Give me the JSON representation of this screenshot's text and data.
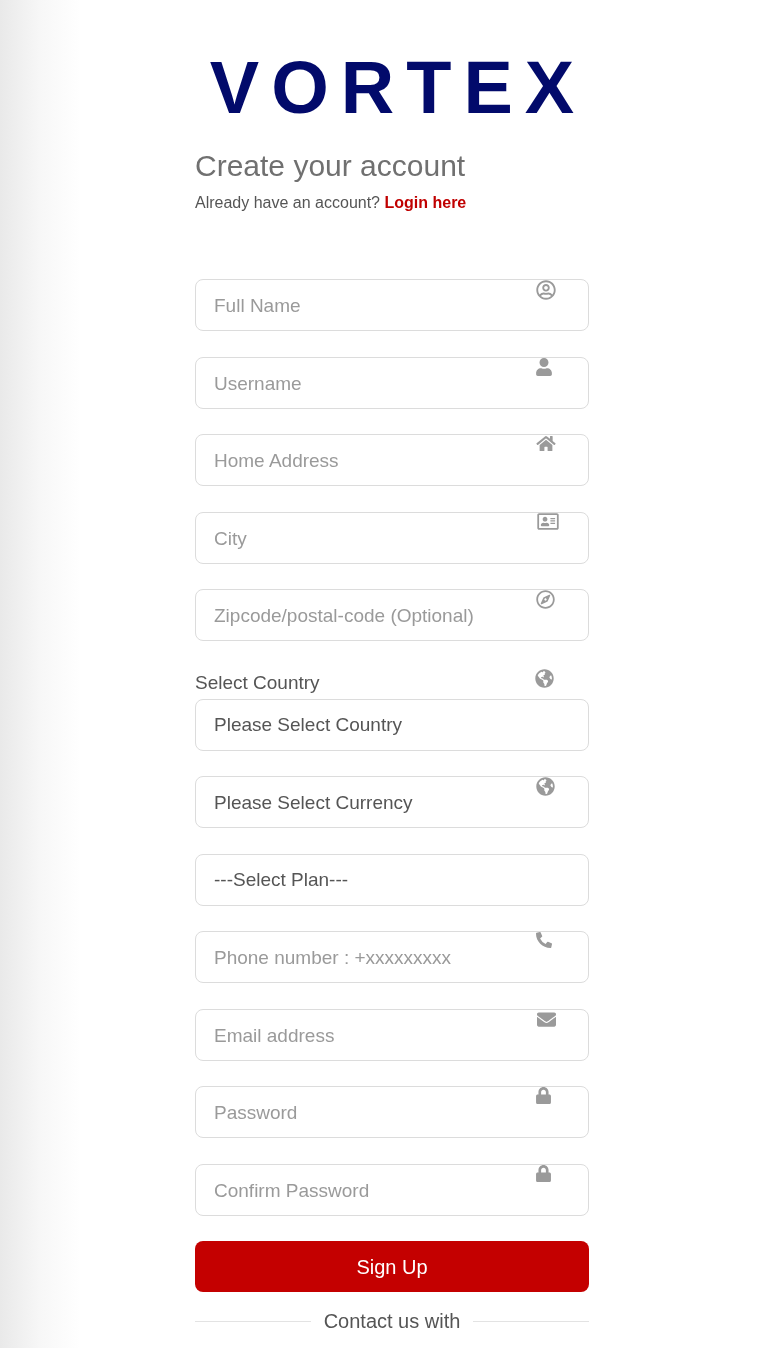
{
  "logo": {
    "text": "VORTEX"
  },
  "heading": "Create your account",
  "login_prompt": {
    "text": "Already have an account?",
    "link": "Login here"
  },
  "fields": [
    {
      "kind": "input",
      "placeholder": "Full Name"
    },
    {
      "kind": "input",
      "placeholder": "Username"
    },
    {
      "kind": "input",
      "placeholder": "Home Address"
    },
    {
      "kind": "input",
      "placeholder": "City"
    },
    {
      "kind": "input",
      "placeholder": "Zipcode/postal-code (Optional)"
    },
    {
      "kind": "label",
      "text": "Select Country"
    },
    {
      "kind": "select",
      "value": "Please Select Country"
    },
    {
      "kind": "select",
      "value": "Please Select Currency"
    },
    {
      "kind": "select",
      "value": "---Select Plan---"
    },
    {
      "kind": "input",
      "placeholder": "Phone number : +xxxxxxxxx"
    },
    {
      "kind": "input",
      "placeholder": "Email address"
    },
    {
      "kind": "input",
      "placeholder": "Password"
    },
    {
      "kind": "input",
      "placeholder": "Confirm Password"
    }
  ],
  "submit_button": {
    "label": "Sign Up"
  },
  "contact_divider": {
    "text": "Contact us with"
  }
}
